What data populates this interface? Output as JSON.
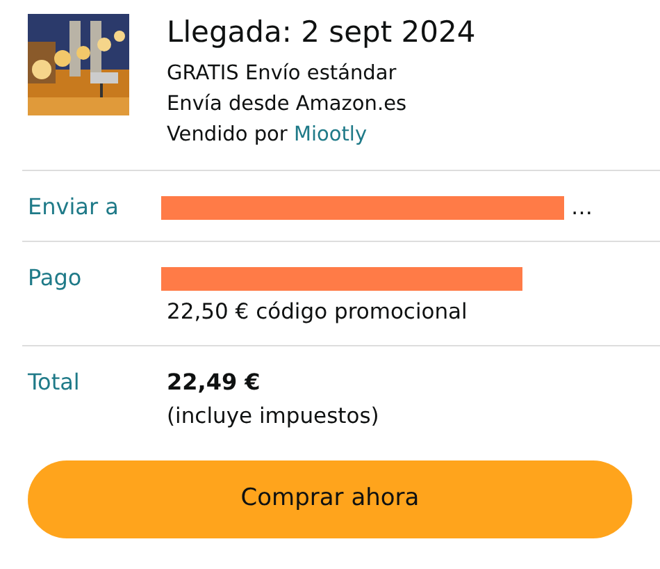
{
  "product": {
    "arrival": "Llegada: 2 sept 2024",
    "shipping": "GRATIS Envío estándar",
    "ships_from": "Envía desde Amazon.es",
    "sold_by_label": "Vendido por",
    "seller": "Miootly"
  },
  "rows": [
    {
      "label": "Enviar a",
      "lines": [
        {
          "kind": "redacted",
          "tail": "…"
        }
      ]
    },
    {
      "label": "Pago",
      "lines": [
        {
          "kind": "redacted"
        },
        {
          "kind": "text",
          "text": "22,50 € código promocional"
        }
      ]
    },
    {
      "label": "Total",
      "lines": [
        {
          "kind": "amount",
          "text": "22,49 €"
        },
        {
          "kind": "text",
          "text": "(incluye impuestos)"
        }
      ]
    }
  ],
  "buy_button": "Comprar ahora"
}
